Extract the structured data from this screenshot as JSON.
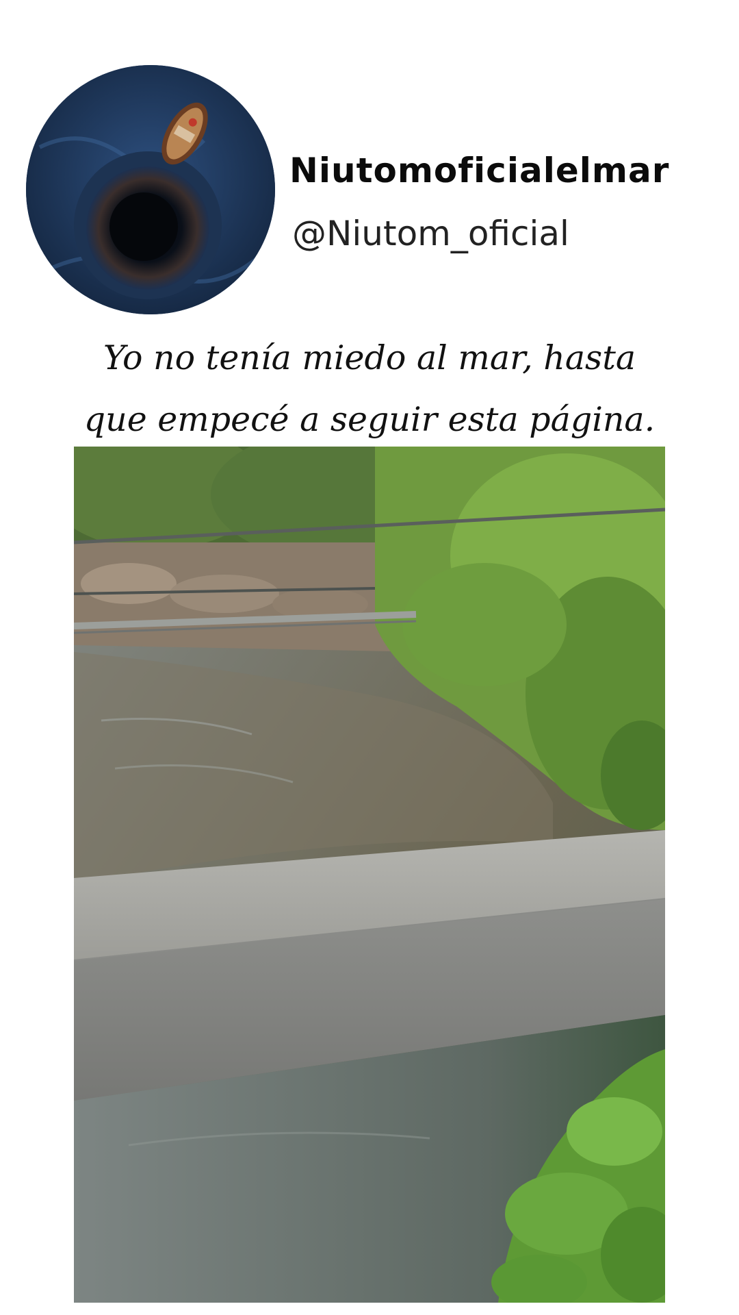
{
  "profile": {
    "display_name": "Niutomoficialelmar",
    "handle": "@Niutom_oficial",
    "avatar_icon": "boat-over-ocean-hole-icon"
  },
  "caption": {
    "line1": "Yo no tenía miedo al mar, hasta",
    "line2": "que empecé a seguir esta página."
  },
  "colors": {
    "text": "#0b0b0b",
    "background": "#ffffff"
  }
}
